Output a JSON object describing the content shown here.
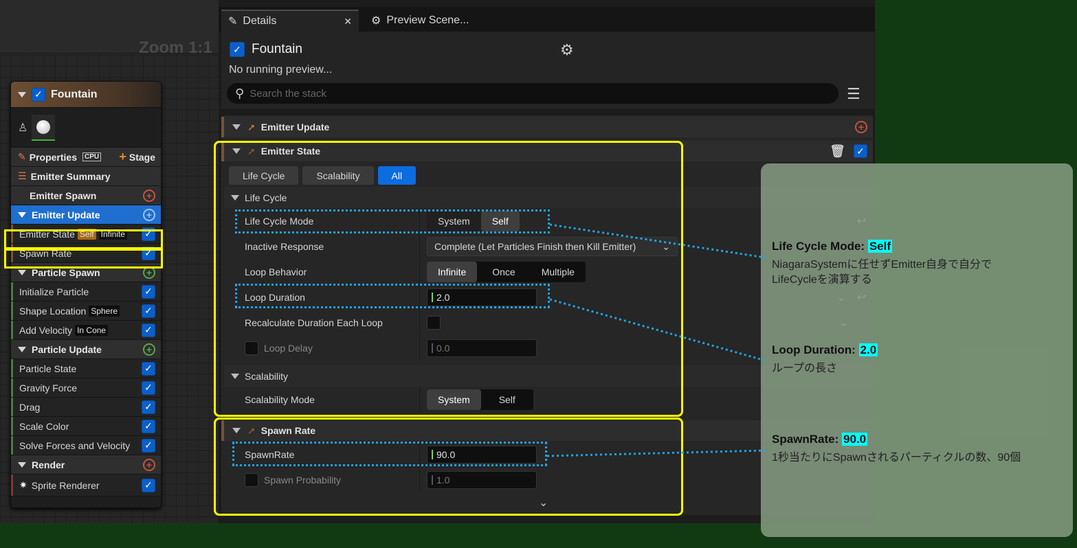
{
  "graph": {
    "zoom_label": "Zoom 1:1"
  },
  "node": {
    "title": "Fountain",
    "properties_label": "Properties",
    "cpu_label": "CPU",
    "stage_label": "Stage",
    "items": {
      "emitter_summary": "Emitter Summary",
      "emitter_spawn": "Emitter Spawn",
      "emitter_update": "Emitter Update",
      "emitter_state": "Emitter State",
      "emitter_state_tag1": "Self",
      "emitter_state_tag2": "Infinite",
      "spawn_rate": "Spawn Rate",
      "particle_spawn": "Particle Spawn",
      "initialize_particle": "Initialize Particle",
      "shape_location": "Shape Location",
      "shape_location_tag": "Sphere",
      "add_velocity": "Add Velocity",
      "add_velocity_tag": "In Cone",
      "particle_update": "Particle Update",
      "particle_state": "Particle State",
      "gravity_force": "Gravity Force",
      "drag": "Drag",
      "scale_color": "Scale Color",
      "solve_forces": "Solve Forces and Velocity",
      "render": "Render",
      "sprite_renderer": "Sprite Renderer"
    }
  },
  "tabs": {
    "details": "Details",
    "preview": "Preview Scene..."
  },
  "details": {
    "emitter_name": "Fountain",
    "preview_status": "No running preview...",
    "search_placeholder": "Search the stack",
    "emitter_update_header": "Emitter Update",
    "emitter_state_header": "Emitter State",
    "filter_tabs": [
      "Life Cycle",
      "Scalability",
      "All"
    ],
    "life_cycle_section": "Life Cycle",
    "life_cycle_mode_label": "Life Cycle Mode",
    "life_cycle_mode_options": [
      "System",
      "Self"
    ],
    "inactive_response_label": "Inactive Response",
    "inactive_response_value": "Complete (Let Particles Finish then Kill Emitter)",
    "loop_behavior_label": "Loop Behavior",
    "loop_behavior_options": [
      "Infinite",
      "Once",
      "Multiple"
    ],
    "loop_duration_label": "Loop Duration",
    "loop_duration_value": "2.0",
    "recalc_label": "Recalculate Duration Each Loop",
    "loop_delay_label": "Loop Delay",
    "loop_delay_value": "0.0",
    "scalability_section": "Scalability",
    "scalability_mode_label": "Scalability Mode",
    "scalability_mode_options": [
      "System",
      "Self"
    ],
    "spawn_rate_header": "Spawn Rate",
    "spawnrate_label": "SpawnRate",
    "spawnrate_value": "90.0",
    "spawn_probability_label": "Spawn Probability",
    "spawn_probability_value": "1.0"
  },
  "annotations": {
    "a1_title": "Life Cycle Mode: ",
    "a1_value": "Self",
    "a1_line1": "NiagaraSystemに任せずEmitter自身で自分で",
    "a1_line2": "LifeCycleを演算する",
    "a2_title": "Loop Duration: ",
    "a2_value": "2.0",
    "a2_line1": "ループの長さ",
    "a3_title": "SpawnRate: ",
    "a3_value": "90.0",
    "a3_line1": "1秒当たりにSpawnされるパーティクルの数、90個"
  },
  "colors": {
    "highlight_yellow": "#ffff00",
    "dotted_blue": "#1fa3e8",
    "annotation_cyan": "#00ffff",
    "selected_blue": "#1f6fd0"
  }
}
